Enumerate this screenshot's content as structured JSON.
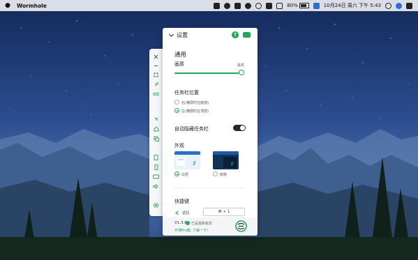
{
  "menubar": {
    "app_name": "Wormhole",
    "battery": "80%",
    "clock": "10月24日 周六 下午 5:43",
    "tray_icons": [
      "monitor-icon",
      "record-icon",
      "shield-icon",
      "bell-icon",
      "moon-icon",
      "box-icon",
      "wifi-icon",
      "battery-icon",
      "input-icon",
      "search-icon",
      "siri-icon",
      "list-icon"
    ]
  },
  "toolbar": {
    "items": [
      "close-icon",
      "minimize-icon",
      "fullscreen-icon",
      "pin-icon",
      "keyboard-icon",
      "expand-icon",
      "home-icon",
      "copy-icon",
      "tablet-icon",
      "phone-icon",
      "screen-icon",
      "volume-icon",
      "settings-icon"
    ]
  },
  "panel": {
    "title": "设置",
    "general": {
      "title": "通用",
      "quality_label": "画质",
      "quality_value_label": "最高",
      "quality_value": 1.0
    },
    "taskbar_position": {
      "title": "任务栏位置",
      "options": [
        "右(横屏时在底部)",
        "左(横屏时在顶部)"
      ],
      "selected": 1
    },
    "auto_hide": {
      "label": "自动隐藏任务栏",
      "enabled": true
    },
    "appearance": {
      "title": "外观",
      "options": [
        "白昼",
        "暗夜"
      ],
      "selected": 0
    },
    "shortcuts": {
      "title": "快捷键",
      "back_label": "返回",
      "back_value": "⌘ + 1"
    },
    "footer": {
      "version": "V1.3.6",
      "status": "已是最新版本",
      "pro_link": "开通Pro版, 了解一下!"
    }
  },
  "colors": {
    "accent": "#27a35b",
    "toggle_on": "#1c2a3c",
    "panel_bg": "#ffffff",
    "sky_top": "#16305f",
    "sky_bottom": "#3b5ea1"
  }
}
